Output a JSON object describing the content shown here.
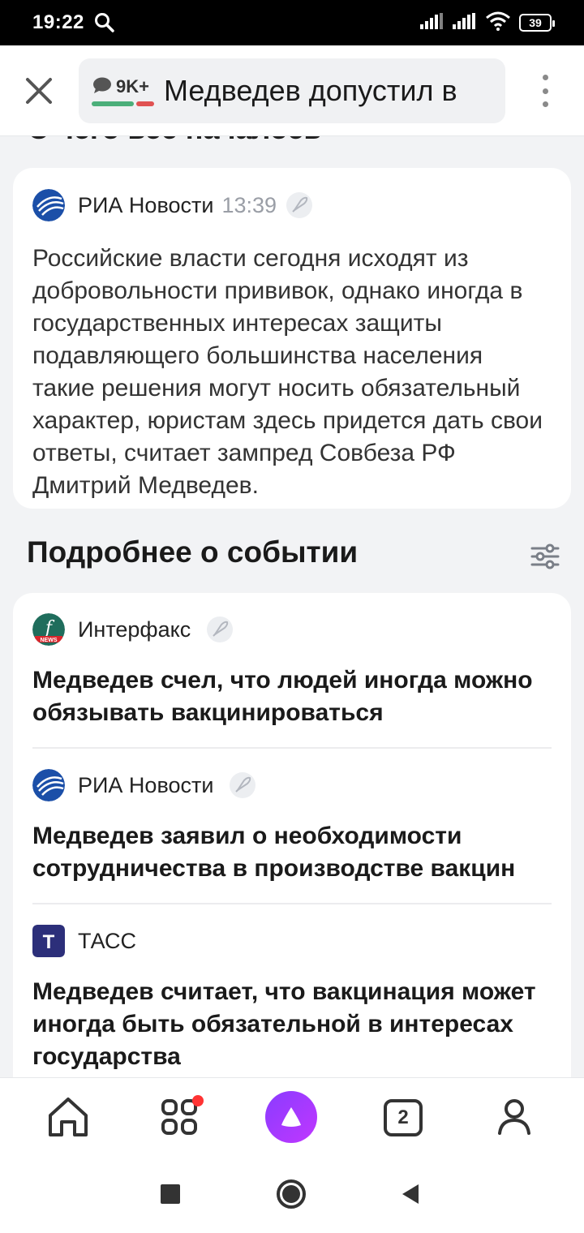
{
  "status_bar": {
    "time": "19:22",
    "battery": "39"
  },
  "header": {
    "comments_count": "9K+",
    "title": "Медведев допустил в"
  },
  "partial_heading": "С чего все началось",
  "quote_card": {
    "source": "РИА Новости",
    "time": "13:39",
    "text": "Российские власти сегодня исходят из добровольности прививок, однако иногда в государственных интересах защиты подавляющего большинства населения такие решения могут носить обязательный характер, юристам здесь придется дать свои ответы, считает зампред Совбеза РФ Дмитрий Медведев."
  },
  "section": {
    "title": "Подробнее о событии"
  },
  "news": [
    {
      "source": "Интерфакс",
      "title": "Медведев счел, что людей иногда можно обязывать вакцинироваться"
    },
    {
      "source": "РИА Новости",
      "title": "Медведев заявил о необходимости сотрудничества в производстве вакцин"
    },
    {
      "source": "ТАСС",
      "title": "Медведев считает, что вакцинация может иногда быть обязательной в интересах государства"
    }
  ],
  "logos": {
    "interfax_letter": "f",
    "interfax_tag": "NEWS",
    "tass_letter": "Т"
  },
  "bottom_nav": {
    "tabs_count": "2"
  },
  "colors": {
    "ria_blue": "#1b4fa8",
    "interfax_green": "#1f6d5c",
    "tass_navy": "#2c2f7a",
    "alice_purple": "#8a3cff",
    "accent_red": "#ff3333",
    "comment_green": "#4caf7a",
    "comment_red": "#e05252"
  }
}
